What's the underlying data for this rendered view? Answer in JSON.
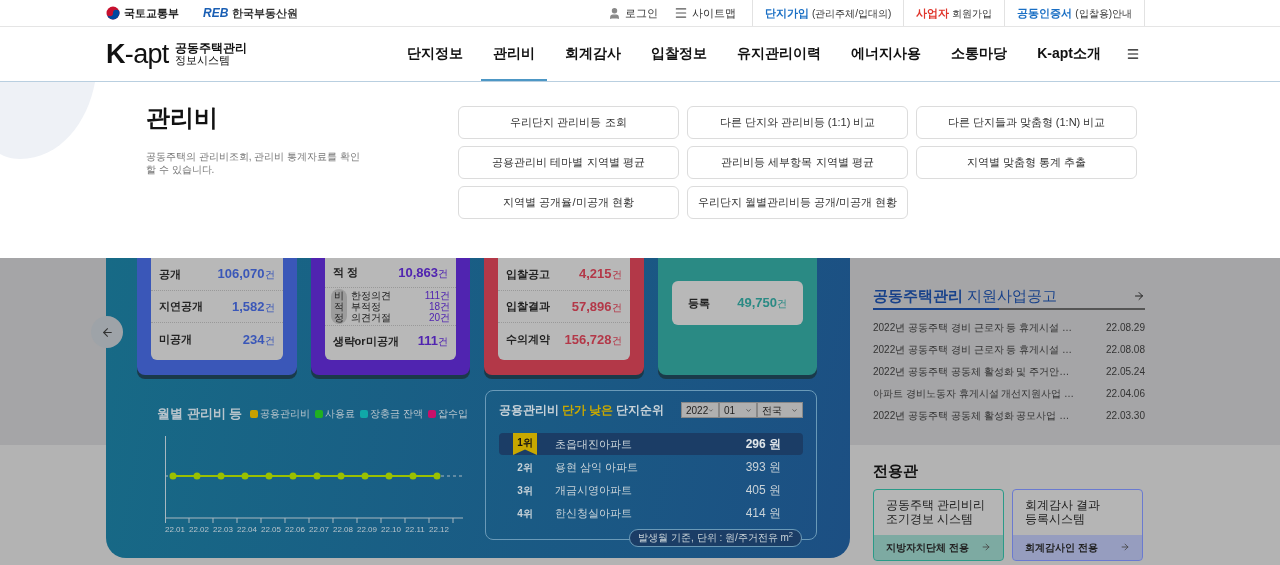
{
  "top_bar": {
    "agencies": [
      {
        "name": "국토교통부",
        "kind": "ministry"
      },
      {
        "name": "한국부동산원",
        "logo_text": "REB",
        "kind": "reb"
      }
    ],
    "utility_links": [
      {
        "label": "로그인",
        "kind": "user"
      },
      {
        "label": "사이트맵",
        "kind": "menu"
      }
    ],
    "signup_links": [
      {
        "strong": "단지가입",
        "rest": "(관리주체/입대의)",
        "color": "#1a6fc4"
      },
      {
        "strong": "사업자",
        "rest": "회원가입",
        "color": "#e0352b"
      },
      {
        "strong": "공동인증서",
        "rest": "(입찰용)안내",
        "color": "#1a6fc4"
      }
    ]
  },
  "header": {
    "logo": {
      "mark": "K-apt",
      "line1": "공동주택관리",
      "line2": "정보시스템"
    },
    "nav": [
      {
        "label": "단지정보",
        "selected": false
      },
      {
        "label": "관리비",
        "selected": true
      },
      {
        "label": "회계감사",
        "selected": false
      },
      {
        "label": "입찰정보",
        "selected": false
      },
      {
        "label": "유지관리이력",
        "selected": false
      },
      {
        "label": "에너지사용",
        "selected": false
      },
      {
        "label": "소통마당",
        "selected": false
      },
      {
        "label": "K-apt소개",
        "selected": false
      }
    ]
  },
  "mega_menu": {
    "title": "관리비",
    "description": "공동주택의 관리비조회, 관리비 통계자료를 확인 할 수 있습니다.",
    "links": [
      "우리단지 관리비등 조회",
      "다른 단지와 관리비등 (1:1) 비교",
      "다른 단지들과 맞춤형 (1:N) 비교",
      "공용관리비 테마별 지역별 평균",
      "관리비등 세부항목 지역별 평균",
      "지역별 맞춤형 통계 추출",
      "지역별 공개율/미공개 현황",
      "우리단지 월별관리비등 공개/미공개 현황"
    ]
  },
  "dashboard": {
    "cards": [
      {
        "kind": "list",
        "color": "#3a57b8",
        "rows": [
          {
            "kind": "row",
            "label": "공개",
            "value": "106,070",
            "unit": "건"
          },
          {
            "kind": "row",
            "label": "지연공개",
            "value": "1,582",
            "unit": "건"
          },
          {
            "kind": "row",
            "label": "미공개",
            "value": "234",
            "unit": "건"
          }
        ]
      },
      {
        "kind": "list",
        "color": "#5024b0",
        "rows": [
          {
            "kind": "row",
            "label": "적 정",
            "value": "10,863",
            "unit": "건"
          },
          {
            "kind": "group",
            "label": "비적정",
            "rows": [
              {
                "label": "한정의견",
                "value": "111",
                "unit": "건"
              },
              {
                "label": "부적정",
                "value": "18",
                "unit": "건"
              },
              {
                "label": "의견거절",
                "value": "20",
                "unit": "건"
              }
            ]
          },
          {
            "kind": "row",
            "label": "생략or미공개",
            "value": "111",
            "unit": "건"
          }
        ]
      },
      {
        "kind": "list",
        "color": "#b33848",
        "rows": [
          {
            "kind": "row",
            "label": "입찰공고",
            "value": "4,215",
            "unit": "건"
          },
          {
            "kind": "row",
            "label": "입찰결과",
            "value": "57,896",
            "unit": "건"
          },
          {
            "kind": "row",
            "label": "수의계약",
            "value": "156,728",
            "unit": "건"
          }
        ]
      },
      {
        "kind": "tile",
        "color": "#2a8a84",
        "rows": [
          {
            "kind": "row",
            "label": "등록",
            "value": "49,750",
            "unit": "건"
          }
        ]
      }
    ],
    "chart": {
      "title": "월별 관리비 등",
      "legend": [
        {
          "label": "공용관리비",
          "color": "#c8a000"
        },
        {
          "label": "사용료",
          "color": "#20b020"
        },
        {
          "label": "장충금 잔액",
          "color": "#10a8a8"
        },
        {
          "label": "잡수입",
          "color": "#c8106a"
        }
      ],
      "x_labels": [
        "22.01",
        "22.02",
        "22.03",
        "22.04",
        "22.05",
        "22.06",
        "22.07",
        "22.08",
        "22.09",
        "22.10",
        "22.11",
        "22.12"
      ]
    },
    "ranking": {
      "title": [
        {
          "text": "공용관리비",
          "highlight": false
        },
        {
          "text": "단가 낮은",
          "highlight": true
        },
        {
          "text": "단지순위",
          "highlight": false
        }
      ],
      "selects": [
        "2022",
        "01",
        "전국"
      ],
      "rows": [
        {
          "rank": "1위",
          "name": "초읍대진아파트",
          "amount": "296 원",
          "selected": true
        },
        {
          "rank": "2위",
          "name": "용현 삼익 아파트",
          "amount": "393 원",
          "selected": false
        },
        {
          "rank": "3위",
          "name": "개금시영아파트",
          "amount": "405 원",
          "selected": false
        },
        {
          "rank": "4위",
          "name": "한신청실아파트",
          "amount": "414 원",
          "selected": false
        }
      ],
      "footnote": "발생월 기준, 단위 : 원/주거전유 m$^{2}$"
    }
  },
  "notices": {
    "title_strong": "공동주택관리",
    "title_rest": "지원사업공고",
    "items": [
      {
        "text": "2022년 공동주택 경비 근로자 등 휴게시설 …",
        "date": "22.08.29"
      },
      {
        "text": "2022년 공동주택 경비 근로자 등 휴게시설 …",
        "date": "22.08.08"
      },
      {
        "text": "2022년 공동주택 공동체 활성화 및 주거안…",
        "date": "22.05.24"
      },
      {
        "text": "아파트 경비노동자 휴게시설 개선지원사업 …",
        "date": "22.04.06"
      },
      {
        "text": "2022년 공동주택 공동체 활성화 공모사업 …",
        "date": "22.03.30"
      }
    ]
  },
  "dedicated": {
    "title": "전용관",
    "cards": [
      {
        "title": "공동주택 관리비리\n조기경보 시스템",
        "footer": "지방자치단체 전용",
        "color": "#2a9a88"
      },
      {
        "title": "회계감사 결과\n등록시스템",
        "footer": "회계감사인 전용",
        "color": "#6a7ad0"
      }
    ]
  }
}
